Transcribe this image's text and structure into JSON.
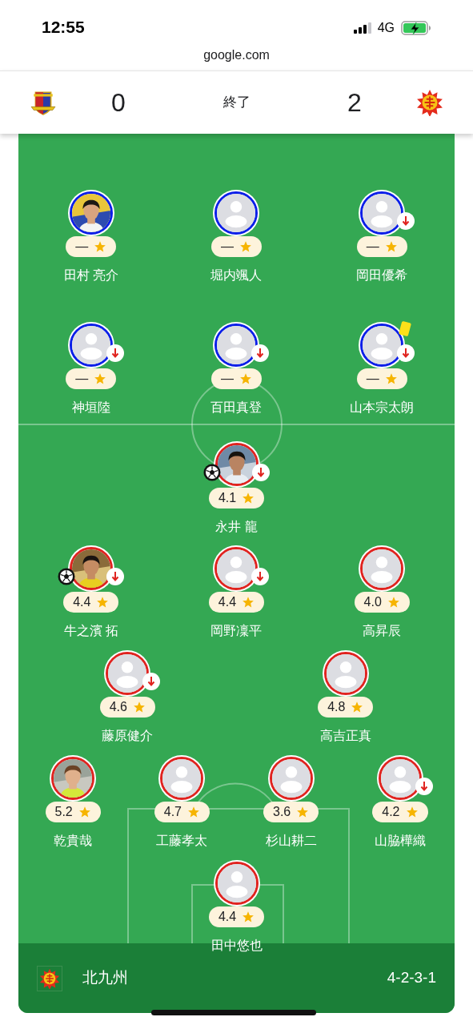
{
  "status_bar": {
    "time": "12:55",
    "network": "4G"
  },
  "address_bar": {
    "url": "google.com"
  },
  "score_header": {
    "home_score": "0",
    "status": "終了",
    "away_score": "2"
  },
  "lineup_rows": [
    {
      "color": "#0a1ee8",
      "players": [
        {
          "name": "田村 亮介",
          "rating": "—",
          "substituted": false,
          "goal": false,
          "yellow_card": false
        },
        {
          "name": "堀内颯人",
          "rating": "—",
          "kind": "placeholder",
          "substituted": false,
          "goal": false,
          "yellow_card": false
        },
        {
          "name": "岡田優希",
          "rating": "—",
          "kind": "placeholder",
          "substituted": true,
          "goal": false,
          "yellow_card": false
        }
      ]
    },
    {
      "color": "#0a1ee8",
      "players": [
        {
          "name": "神垣陸",
          "rating": "—",
          "kind": "placeholder",
          "substituted": true,
          "goal": false,
          "yellow_card": false
        },
        {
          "name": "百田真登",
          "rating": "—",
          "kind": "placeholder",
          "substituted": true,
          "goal": false,
          "yellow_card": false
        },
        {
          "name": "山本宗太朗",
          "rating": "—",
          "kind": "placeholder",
          "substituted": true,
          "goal": false,
          "yellow_card": true
        }
      ]
    },
    {
      "color": "#e0231f",
      "players": [
        {
          "name": "永井 龍",
          "rating": "4.1",
          "substituted": true,
          "goal": true,
          "yellow_card": false
        }
      ]
    },
    {
      "color": "#e0231f",
      "players": [
        {
          "name": "牛之濱 拓",
          "rating": "4.4",
          "substituted": true,
          "goal": true,
          "yellow_card": false
        },
        {
          "name": "岡野凜平",
          "rating": "4.4",
          "kind": "placeholder",
          "substituted": true,
          "goal": false,
          "yellow_card": false
        },
        {
          "name": "高昇辰",
          "rating": "4.0",
          "kind": "placeholder",
          "substituted": false,
          "goal": false,
          "yellow_card": false
        }
      ]
    },
    {
      "color": "#e0231f",
      "players": [
        {
          "name": "藤原健介",
          "rating": "4.6",
          "kind": "placeholder",
          "substituted": true,
          "goal": false,
          "yellow_card": false
        },
        {
          "name": "高吉正真",
          "rating": "4.8",
          "kind": "placeholder",
          "substituted": false,
          "goal": false,
          "yellow_card": false
        }
      ]
    },
    {
      "color": "#e0231f",
      "players": [
        {
          "name": "乾貴哉",
          "rating": "5.2",
          "substituted": false,
          "goal": false,
          "yellow_card": false
        },
        {
          "name": "工藤孝太",
          "rating": "4.7",
          "kind": "placeholder",
          "substituted": false,
          "goal": false,
          "yellow_card": false
        },
        {
          "name": "杉山耕二",
          "rating": "3.6",
          "kind": "placeholder",
          "substituted": false,
          "goal": false,
          "yellow_card": false
        },
        {
          "name": "山脇樺織",
          "rating": "4.2",
          "kind": "placeholder",
          "substituted": true,
          "goal": false,
          "yellow_card": false
        }
      ]
    },
    {
      "color": "#e0231f",
      "players": [
        {
          "name": "田中悠也",
          "rating": "4.4",
          "kind": "placeholder",
          "substituted": false,
          "goal": false,
          "yellow_card": false
        }
      ]
    }
  ],
  "team_bar": {
    "name": "北九州",
    "formation": "4-2-3-1"
  }
}
